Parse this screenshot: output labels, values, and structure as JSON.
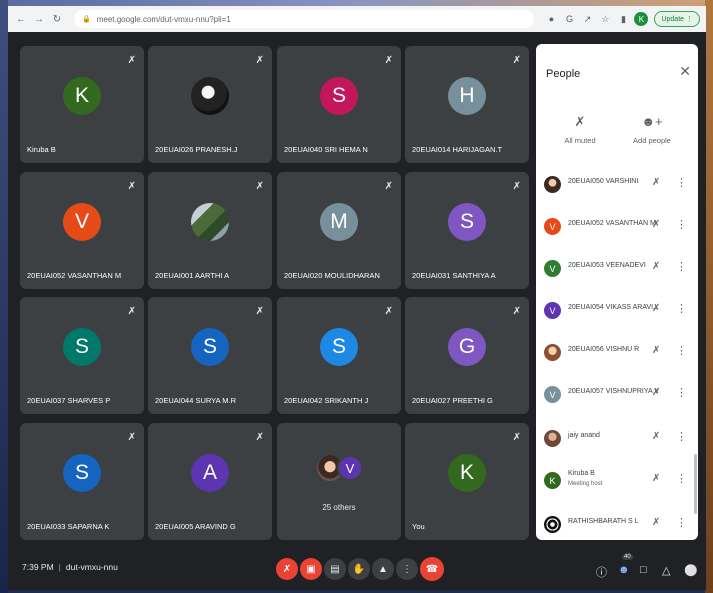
{
  "browser": {
    "url": "meet.google.com/dut-vmxu-nnu?pli=1",
    "update_label": "Update",
    "profile_initial": "K"
  },
  "tiles": [
    {
      "name": "Kiruba B",
      "initial": "K",
      "color": "#33691e"
    },
    {
      "name": "20EUAI026 PRANESH.J",
      "initial": "",
      "color": ""
    },
    {
      "name": "20EUAI040 SRI HEMA N",
      "initial": "S",
      "color": "#c2185b"
    },
    {
      "name": "20EUAI014 HARIJAGAN.T",
      "initial": "H",
      "color": "#78909c"
    },
    {
      "name": "20EUAI052 VASANTHAN M",
      "initial": "V",
      "color": "#e64a19"
    },
    {
      "name": "20EUAI001 AARTHI A",
      "initial": "",
      "color": ""
    },
    {
      "name": "20EUAI020 MOULIDHARAN",
      "initial": "M",
      "color": "#78909c"
    },
    {
      "name": "20EUAI031 SANTHIYA A",
      "initial": "S",
      "color": "#7e57c2"
    },
    {
      "name": "20EUAI037 SHARVES P",
      "initial": "S",
      "color": "#00796b"
    },
    {
      "name": "20EUAI044 SURYA M.R",
      "initial": "S",
      "color": "#1565c0"
    },
    {
      "name": "20EUAI042 SRIKANTH J",
      "initial": "S",
      "color": "#1e88e5"
    },
    {
      "name": "20EUAI027 PREETHI G",
      "initial": "G",
      "color": "#7e57c2"
    },
    {
      "name": "20EUAI033 SAPARNA K",
      "initial": "S",
      "color": "#1565c0"
    },
    {
      "name": "20EUAI005 ARAVIND G",
      "initial": "A",
      "color": "#5e35b1"
    },
    {
      "name": "",
      "initial": "V",
      "color": "#5e35b1",
      "others": "25 others"
    },
    {
      "name": "You",
      "initial": "K",
      "color": "#33691e"
    }
  ],
  "people_panel": {
    "title": "People",
    "all_muted_label": "All muted",
    "add_people_label": "Add people",
    "participants": [
      {
        "name": "20EUAI050 VARSHINI",
        "initial": "",
        "color": ""
      },
      {
        "name": "20EUAI052 VASANTHAN M",
        "initial": "V",
        "color": "#e64a19"
      },
      {
        "name": "20EUAI053 VEENADEVI",
        "initial": "V",
        "color": "#2e7d32"
      },
      {
        "name": "20EUAI054 VIKASS ARAVI...",
        "initial": "V",
        "color": "#5e35b1"
      },
      {
        "name": "20EUAI056 VISHNU R",
        "initial": "",
        "color": ""
      },
      {
        "name": "20EUAI057 VISHNUPRIYA V",
        "initial": "V",
        "color": "#78909c"
      },
      {
        "name": "jaiy anand",
        "initial": "",
        "color": ""
      },
      {
        "name": "Kiruba B",
        "sub": "Meeting host",
        "initial": "K",
        "color": "#33691e"
      },
      {
        "name": "RATHISHBARATH S L",
        "initial": "",
        "color": ""
      }
    ]
  },
  "bottom_bar": {
    "time": "7:39 PM",
    "meeting_code": "dut-vmxu-nnu",
    "participant_count": "40"
  }
}
